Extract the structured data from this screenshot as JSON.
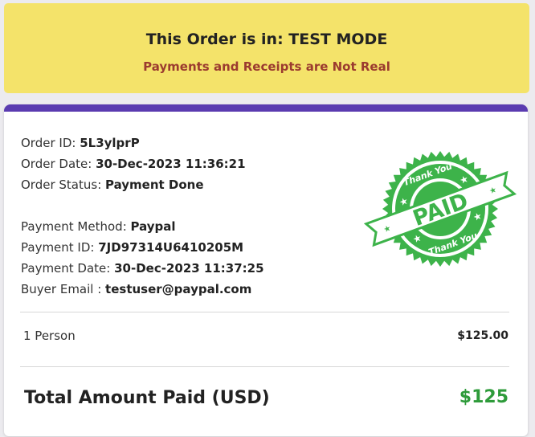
{
  "banner": {
    "title": "This Order is in: TEST MODE",
    "subtitle": "Payments and Receipts are Not Real"
  },
  "order": {
    "id_label": "Order ID: ",
    "id": "5L3ylprP",
    "date_label": "Order Date: ",
    "date": "30-Dec-2023 11:36:21",
    "status_label": "Order Status: ",
    "status": "Payment Done"
  },
  "payment": {
    "method_label": "Payment Method: ",
    "method": "Paypal",
    "id_label": "Payment ID: ",
    "id": "7JD97314U6410205M",
    "date_label": "Payment Date: ",
    "date": "30-Dec-2023 11:37:25",
    "email_label": "Buyer Email : ",
    "email": "testuser@paypal.com"
  },
  "items": [
    {
      "label": "1 Person",
      "amount": "$125.00"
    }
  ],
  "total": {
    "label": "Total Amount Paid (USD)",
    "amount": "$125"
  },
  "stamp": {
    "main_text": "PAID",
    "top_text": "Thank You",
    "bottom_text": "Thank You",
    "color": "#3db34a"
  },
  "colors": {
    "banner_bg": "#f4e36a",
    "accent_bar": "#5a3bb0",
    "subtitle": "#9b3b2f",
    "total_amount": "#2e9b3a"
  }
}
